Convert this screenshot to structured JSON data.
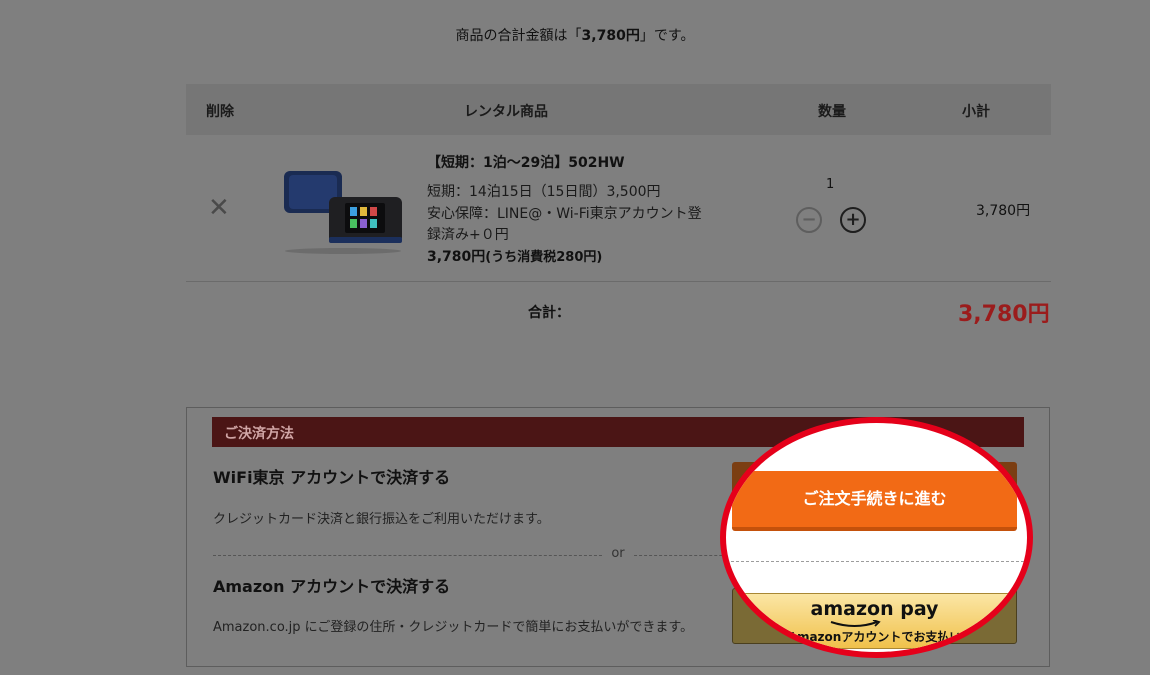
{
  "summary": {
    "prefix": "商品の合計金額は「",
    "amount": "3,780円",
    "suffix": "」です。"
  },
  "table": {
    "headers": {
      "delete": "削除",
      "product": "レンタル商品",
      "qty": "数量",
      "subtotal": "小計"
    },
    "row": {
      "delete_icon": "close-icon",
      "title": "【短期：1泊～29泊】502HW",
      "line1": "短期：14泊15日（15日間）3,500円",
      "line2": "安心保障：LINE@・Wi-Fi東京アカウント登",
      "line3": "録済み+０円",
      "price": "3,780円",
      "tax_note": "(うち消費税280円)",
      "qty": "1",
      "minus_label": "−",
      "plus_label": "+",
      "subtotal": "3,780円"
    },
    "total_label": "合計：",
    "total_value": "3,780円"
  },
  "payment": {
    "header": "ご決済方法",
    "method1": {
      "title": "WiFi東京 アカウントで決済する",
      "desc": "クレジットカード決済と銀行振込をご利用いただけます。"
    },
    "or": "or",
    "method2": {
      "title": "Amazon アカウントで決済する",
      "desc": "Amazon.co.jp にご登録の住所・クレジットカードで簡単にお支払いができます。"
    },
    "order_button": "ご注文手続きに進む",
    "amazon_button": {
      "logo": "amazon pay",
      "sub": "Amazonアカウントでお支払い",
      "chevron": "›"
    }
  },
  "colors": {
    "overlay": "#7f7f7f",
    "order": "#f26a15",
    "highlight": "#e5001a",
    "total": "#9b1c1c"
  }
}
